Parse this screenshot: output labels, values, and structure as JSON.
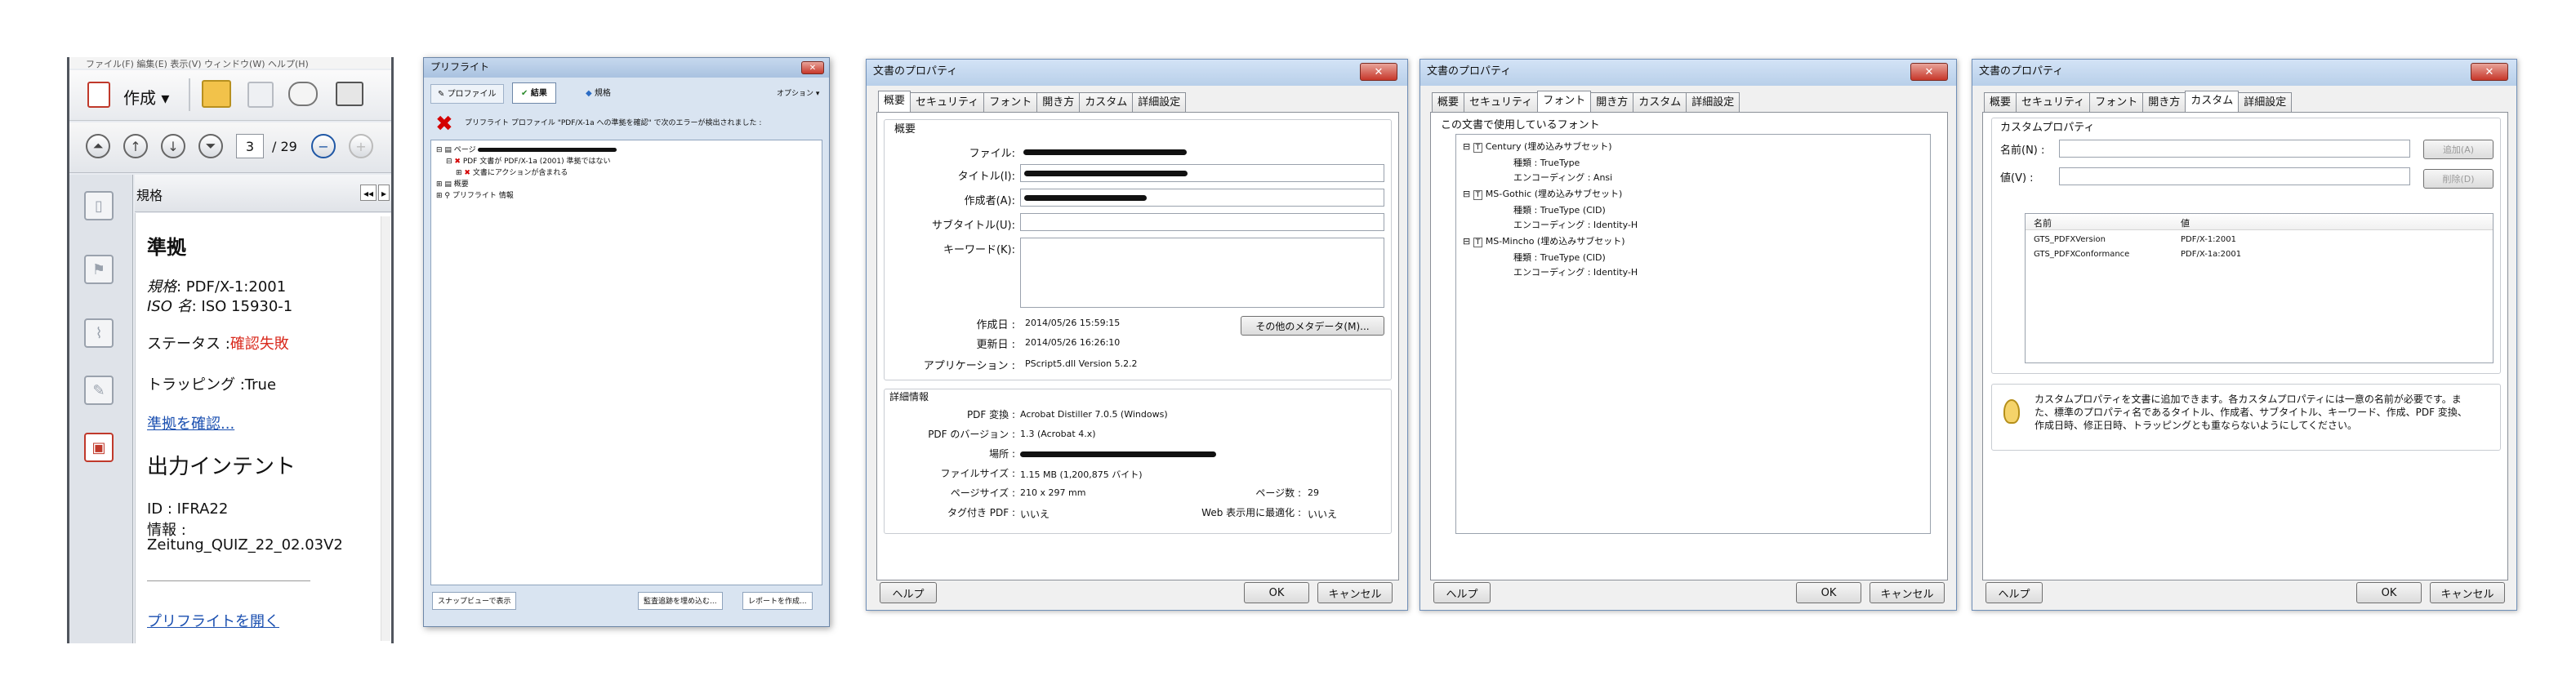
{
  "p1": {
    "menubar": "ファイル(F)  編集(E)  表示(V)  ウィンドウ(W)  ヘルプ(H)",
    "create_label": "作成",
    "page_current": "3",
    "page_total": "/ 29",
    "pane_title": "規格",
    "heading_compliance": "準拠",
    "standard_label": "規格",
    "standard_value": ": PDF/X-1:2001",
    "iso_label": "ISO 名",
    "iso_value": ": ISO 15930-1",
    "status_label": "ステータス :",
    "status_value": "確認失敗",
    "trapping": "トラッピング :True",
    "verify_link": "準拠を確認...",
    "heading_output": "出力インテント",
    "id_line": "ID : IFRA22",
    "info_label": "情報 :",
    "info_value": "Zeitung_QUIZ_22_02.03V2",
    "open_preflight": "プリフライトを開く"
  },
  "p2": {
    "title": "プリフライト",
    "tab_profile": "プロファイル",
    "tab_results": "結果",
    "tab_standards": "規格",
    "options": "オプション ▾",
    "error_message": "プリフライト プロファイル \"PDF/X-1a への準拠を確認\" で次のエラーが検出されました :",
    "tree_item1": "ページ",
    "tree_item2": "PDF 文書が PDF/X-1a (2001) 準拠ではない",
    "tree_item3": "文書にアクションが含まれる",
    "tree_item4": "概要",
    "tree_item5": "プリフライト 情報",
    "btn_snap": "スナップビューで表示",
    "btn_verify": "監査追跡を埋め込む...",
    "btn_report": "レポートを作成..."
  },
  "dlg_common": {
    "title": "文書のプロパティ",
    "tabs": [
      "概要",
      "セキュリティ",
      "フォント",
      "開き方",
      "カスタム",
      "詳細設定"
    ],
    "help": "ヘルプ",
    "ok": "OK",
    "cancel": "キャンセル"
  },
  "d1": {
    "section_summary": "概要",
    "file_label": "ファイル:",
    "title_label": "タイトル(I):",
    "author_label": "作成者(A):",
    "subtitle_label": "サブタイトル(U):",
    "keywords_label": "キーワード(K):",
    "created_label": "作成日 :",
    "created_value": "2014/05/26 15:59:15",
    "modified_label": "更新日 :",
    "modified_value": "2014/05/26 16:26:10",
    "app_label": "アプリケーション :",
    "app_value": "PScript5.dll Version 5.2.2",
    "more_meta": "その他のメタデータ(M)...",
    "section_detail": "詳細情報",
    "producer_label": "PDF 変換 :",
    "producer_value": "Acrobat Distiller 7.0.5 (Windows)",
    "version_label": "PDF のバージョン :",
    "version_value": "1.3 (Acrobat 4.x)",
    "location_label": "場所 :",
    "size_label": "ファイルサイズ :",
    "size_value": "1.15 MB (1,200,875 バイト)",
    "page_size_label": "ページサイズ :",
    "page_size_value": "210 x 297 mm",
    "pages_label": "ページ数 :",
    "pages_value": "29",
    "tagged_label": "タグ付き PDF :",
    "tagged_value": "いいえ",
    "web_label": "Web 表示用に最適化 :",
    "web_value": "いいえ"
  },
  "d2": {
    "section": "この文書で使用しているフォント",
    "fonts": [
      {
        "name": "Century (埋め込みサブセット)",
        "type": "種類 : TrueType",
        "enc": "エンコーディング : Ansi"
      },
      {
        "name": "MS-Gothic (埋め込みサブセット)",
        "type": "種類 : TrueType (CID)",
        "enc": "エンコーディング : Identity-H"
      },
      {
        "name": "MS-Mincho (埋め込みサブセット)",
        "type": "種類 : TrueType (CID)",
        "enc": "エンコーディング : Identity-H"
      }
    ]
  },
  "d3": {
    "section": "カスタムプロパティ",
    "name_label": "名前(N) :",
    "value_label": "値(V) :",
    "add_btn": "追加(A)",
    "delete_btn": "削除(D)",
    "col_name": "名前",
    "col_value": "値",
    "rows": [
      {
        "name": "GTS_PDFXVersion",
        "value": "PDF/X-1:2001"
      },
      {
        "name": "GTS_PDFXConformance",
        "value": "PDF/X-1a:2001"
      }
    ],
    "info": "カスタムプロパティを文書に追加できます。各カスタムプロパティには一意の名前が必要です。また、標準のプロパティ名であるタイトル、作成者、サブタイトル、キーワード、作成、PDF 変換、作成日時、修正日時、トラッピングとも重ならないようにしてください。"
  },
  "colors": {
    "error_red": "#d40000",
    "link_blue": "#1a4fb0",
    "status_red": "#d9291c"
  }
}
